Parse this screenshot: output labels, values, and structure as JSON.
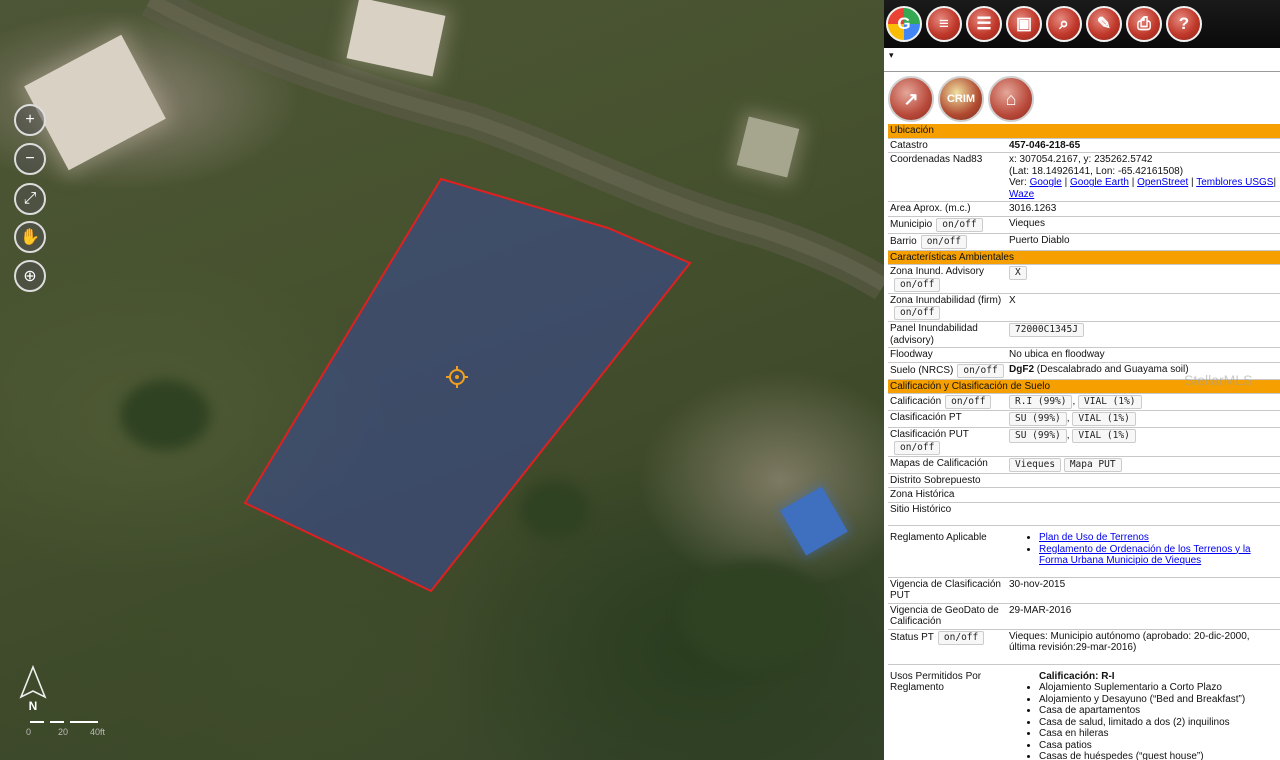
{
  "map": {
    "controls": [
      {
        "name": "zoom-in",
        "icon": "zoom-in-icon",
        "glyph": "+"
      },
      {
        "name": "zoom-out",
        "icon": "zoom-out-icon",
        "glyph": "−"
      },
      {
        "name": "full-extent",
        "icon": "full-extent-icon",
        "glyph": "⤢"
      },
      {
        "name": "pan",
        "icon": "pan-icon",
        "glyph": "✋"
      },
      {
        "name": "add-bookmark",
        "icon": "bookmark-icon",
        "glyph": "⊕"
      }
    ],
    "north_label": "N",
    "scale_labels": [
      "0",
      "20",
      "40ft"
    ],
    "parcel_color": "#3a4a8c",
    "parcel_border": "#e02020"
  },
  "toolbar": {
    "buttons": [
      {
        "name": "google-maps",
        "icon": "google-maps-icon",
        "glyph": "G"
      },
      {
        "name": "layers",
        "icon": "layers-icon",
        "glyph": "≡"
      },
      {
        "name": "layers-2",
        "icon": "layers-stack-icon",
        "glyph": "☰"
      },
      {
        "name": "identify",
        "icon": "identify-icon",
        "glyph": "▣"
      },
      {
        "name": "search",
        "icon": "search-icon",
        "glyph": "⌕"
      },
      {
        "name": "draw",
        "icon": "pencil-ruler-icon",
        "glyph": "✎"
      },
      {
        "name": "print",
        "icon": "printer-icon",
        "glyph": "⎙"
      },
      {
        "name": "help",
        "icon": "help-icon",
        "glyph": "?"
      }
    ],
    "collapse_glyph": "▾"
  },
  "layer_buttons": [
    {
      "name": "link",
      "icon": "link-icon",
      "glyph": "↗"
    },
    {
      "name": "crim",
      "icon": "crim-logo-icon",
      "glyph": "CRIM"
    },
    {
      "name": "flood-house",
      "icon": "flood-house-icon",
      "glyph": "⌂"
    }
  ],
  "sections": {
    "ubicacion": "Ubicación",
    "ambientales": "Características Ambientales",
    "calificacion": "Calificación y Clasificación de Suelo"
  },
  "rows": {
    "catastro": {
      "label": "Catastro",
      "value": "457-046-218-65"
    },
    "coordenadas": {
      "label": "Coordenadas Nad83",
      "xy": "x: 307054.2167, y: 235262.5742",
      "latlon": "(Lat: 18.14926141, Lon: -65.42161508)",
      "ver": "Ver:",
      "links": [
        "Google",
        "Google Earth",
        "OpenStreet",
        "Temblores USGS",
        "Waze"
      ]
    },
    "area": {
      "label": "Area Aprox. (m.c.)",
      "value": "3016.1263"
    },
    "municipio": {
      "label": "Municipio",
      "toggle": "on/off",
      "value": "Vieques"
    },
    "barrio": {
      "label": "Barrio",
      "toggle": "on/off",
      "value": "Puerto Diablo"
    },
    "zona_advisory": {
      "label": "Zona Inund. Advisory",
      "toggle": "on/off",
      "value": "X"
    },
    "zona_firm": {
      "label": "Zona Inundabilidad (firm)",
      "toggle": "on/off",
      "value": "X"
    },
    "panel": {
      "label": "Panel Inundabilidad (advisory)",
      "value": "72000C1345J"
    },
    "floodway": {
      "label": "Floodway",
      "value": "No ubica en floodway"
    },
    "suelo": {
      "label": "Suelo (NRCS)",
      "toggle": "on/off",
      "code": "DgF2",
      "value": "(Descalabrado and Guayama soil)"
    },
    "calificacion": {
      "label": "Calificación",
      "toggle": "on/off",
      "values": [
        "R.I (99%)",
        "VIAL (1%)"
      ]
    },
    "clas_pt": {
      "label": "Clasificación PT",
      "values": [
        "SU (99%)",
        "VIAL (1%)"
      ]
    },
    "clas_put": {
      "label": "Clasificación PUT",
      "toggle": "on/off",
      "values": [
        "SU (99%)",
        "VIAL (1%)"
      ]
    },
    "mapas": {
      "label": "Mapas de Calificación",
      "values": [
        "Vieques",
        "Mapa PUT"
      ]
    },
    "distrito": {
      "label": "Distrito Sobrepuesto",
      "value": ""
    },
    "zona_historica": {
      "label": "Zona Histórica",
      "value": ""
    },
    "sitio_historico": {
      "label": "Sitio Histórico",
      "value": ""
    },
    "reglamento": {
      "label": "Reglamento Aplicable",
      "links": [
        "Plan de Uso de Terrenos",
        "Reglamento de Ordenación de los Terrenos y la Forma Urbana Municipio de Vieques"
      ]
    },
    "vigencia_put": {
      "label": "Vigencia de Clasificación PUT",
      "value": "30-nov-2015"
    },
    "vigencia_geo": {
      "label": "Vigencia de GeoDato de Calificación",
      "value": "29-MAR-2016"
    },
    "status_pt": {
      "label": "Status PT",
      "toggle": "on/off",
      "value": "Vieques: Municipio autónomo (aprobado: 20-dic-2000, última revisión:29-mar-2016)"
    },
    "usos": {
      "label": "Usos Permitidos Por Reglamento",
      "heading": "Calificación: R-I",
      "items": [
        "Alojamiento Suplementario a Corto Plazo",
        "Alojamiento y Desayuno (“Bed and Breakfast”)",
        "Casa de apartamentos",
        "Casa de salud, limitado a dos (2) inquilinos",
        "Casa en hileras",
        "Casa patios",
        "Casas de huéspedes (“guest house”)"
      ]
    }
  },
  "watermark": "StellarMLS"
}
